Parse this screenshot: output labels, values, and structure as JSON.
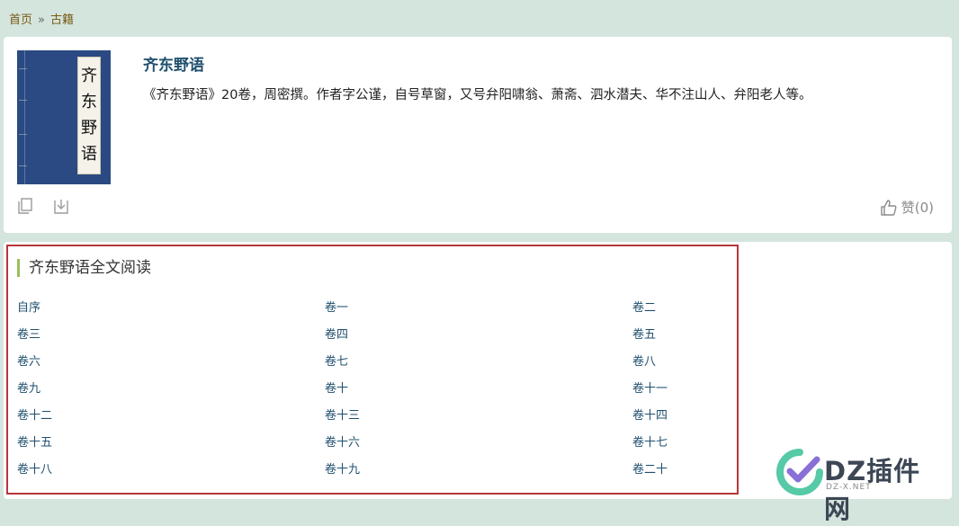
{
  "breadcrumb": {
    "home": "首页",
    "separator": "»",
    "current": "古籍"
  },
  "book": {
    "cover_chars": [
      "齐",
      "东",
      "野",
      "语"
    ],
    "title": "齐东野语",
    "description": "《齐东野语》20卷，周密撰。作者字公谨，自号草窗，又号弁阳啸翁、萧斋、泗水潜夫、华不注山人、弁阳老人等。",
    "like_label": "赞(0)"
  },
  "toc": {
    "heading": "齐东野语全文阅读",
    "chapters": [
      "自序",
      "卷一",
      "卷二",
      "卷三",
      "卷四",
      "卷五",
      "卷六",
      "卷七",
      "卷八",
      "卷九",
      "卷十",
      "卷十一",
      "卷十二",
      "卷十三",
      "卷十四",
      "卷十五",
      "卷十六",
      "卷十七",
      "卷十八",
      "卷十九",
      "卷二十"
    ]
  },
  "watermark": {
    "text": "DZ插件网",
    "sub": "DZ-X.NET"
  }
}
